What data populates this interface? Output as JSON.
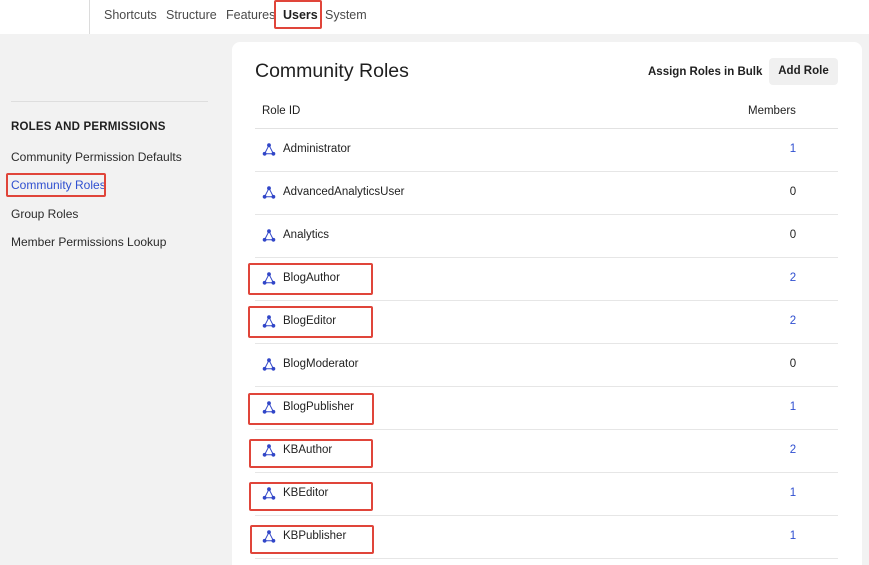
{
  "nav": {
    "tabs": [
      {
        "label": "Shortcuts"
      },
      {
        "label": "Structure"
      },
      {
        "label": "Features"
      },
      {
        "label": "Users"
      },
      {
        "label": "System"
      }
    ],
    "active": "Users"
  },
  "sidebar": {
    "heading": "ROLES AND PERMISSIONS",
    "items": [
      {
        "label": "Community Permission Defaults"
      },
      {
        "label": "Community Roles"
      },
      {
        "label": "Group Roles"
      },
      {
        "label": "Member Permissions Lookup"
      }
    ],
    "active": "Community Roles"
  },
  "main": {
    "title": "Community Roles",
    "assign_bulk_label": "Assign Roles in Bulk",
    "add_role_label": "Add Role",
    "columns": {
      "role_id": "Role ID",
      "members": "Members"
    },
    "rows": [
      {
        "name": "Administrator",
        "members": "1"
      },
      {
        "name": "AdvancedAnalyticsUser",
        "members": "0"
      },
      {
        "name": "Analytics",
        "members": "0"
      },
      {
        "name": "BlogAuthor",
        "members": "2"
      },
      {
        "name": "BlogEditor",
        "members": "2"
      },
      {
        "name": "BlogModerator",
        "members": "0"
      },
      {
        "name": "BlogPublisher",
        "members": "1"
      },
      {
        "name": "KBAuthor",
        "members": "2"
      },
      {
        "name": "KBEditor",
        "members": "1"
      },
      {
        "name": "KBPublisher",
        "members": "1"
      }
    ]
  },
  "colors": {
    "accent": "#2f4fd0",
    "highlight_box": "#e0453a",
    "icon": "#3146c8"
  }
}
